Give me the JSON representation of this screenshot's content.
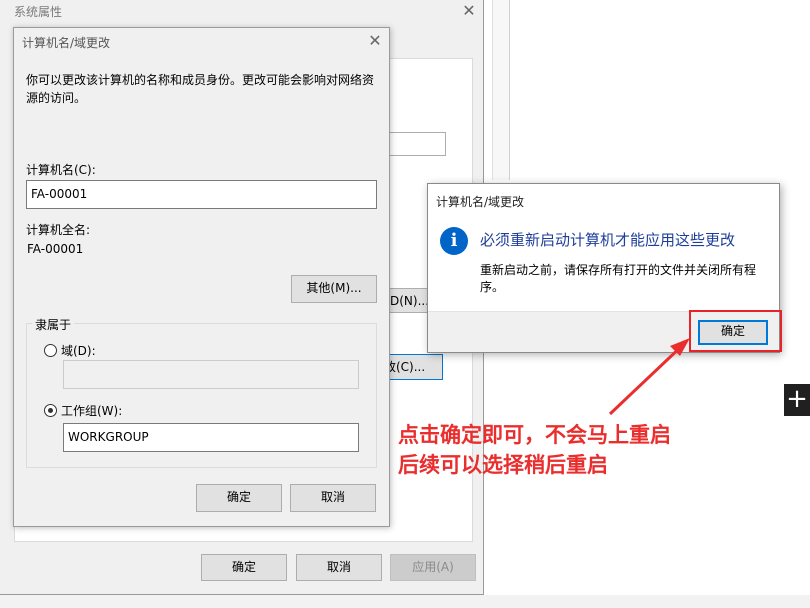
{
  "system_properties": {
    "title": "系统属性",
    "change_partial": "改(C)...",
    "network_id_partial": "D(N)...",
    "ok": "确定",
    "cancel": "取消",
    "apply": "应用(A)"
  },
  "computer_name_dialog": {
    "title": "计算机名/域更改",
    "description": "你可以更改该计算机的名称和成员身份。更改可能会影响对网络资源的访问。",
    "computer_name_label": "计算机名(C):",
    "computer_name_value": "FA-00001",
    "full_name_label": "计算机全名:",
    "full_name_value": "FA-00001",
    "more_button": "其他(M)...",
    "member_of_label": "隶属于",
    "domain_label": "域(D):",
    "domain_value": "",
    "workgroup_label": "工作组(W):",
    "workgroup_value": "WORKGROUP",
    "domain_selected": false,
    "workgroup_selected": true,
    "ok": "确定",
    "cancel": "取消"
  },
  "restart_message": {
    "title": "计算机名/域更改",
    "icon": "info-icon",
    "main_text": "必须重新启动计算机才能应用这些更改",
    "sub_text": "重新启动之前，请保存所有打开的文件并关闭所有程序。",
    "ok": "确定"
  },
  "annotation": {
    "line1": "点击确定即可，不会马上重启",
    "line2": "后续可以选择稍后重启",
    "color": "#ea2d2d"
  },
  "side_toolbar": {
    "plus_icon": "plus-icon"
  },
  "colors": {
    "accent": "#0078d7",
    "info_blue": "#0064c8",
    "highlight_red": "#e8242a"
  }
}
